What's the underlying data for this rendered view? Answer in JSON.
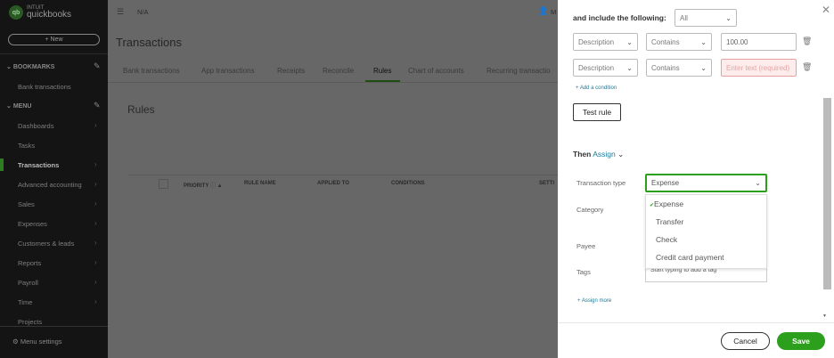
{
  "sidebar": {
    "logo_top": "INTUIT",
    "logo_bottom": "quickbooks",
    "new_label": "+ New",
    "bookmarks_label": "BOOKMARKS",
    "bookmark_items": [
      "Bank transactions"
    ],
    "menu_label": "MENU",
    "menu_items": [
      "Dashboards",
      "Tasks",
      "Transactions",
      "Advanced accounting",
      "Sales",
      "Expenses",
      "Customers & leads",
      "Reports",
      "Payroll",
      "Time",
      "Projects"
    ],
    "active_item": "Transactions",
    "menu_settings": "Menu settings"
  },
  "header": {
    "company": "N/A",
    "user_initial": "M"
  },
  "main": {
    "title": "Transactions",
    "tabs": [
      "Bank transactions",
      "App transactions",
      "Receipts",
      "Reconcile",
      "Rules",
      "Chart of accounts",
      "Recurring transactio"
    ],
    "active_tab": "Rules",
    "section_title": "Rules",
    "columns": [
      "PRIORITY",
      "RULE NAME",
      "APPLIED TO",
      "CONDITIONS",
      "SETTI"
    ]
  },
  "panel": {
    "include_label": "and include the following:",
    "include_value": "All",
    "conditions": [
      {
        "field": "Description",
        "operator": "Contains",
        "value": "100.00",
        "placeholder": ""
      },
      {
        "field": "Description",
        "operator": "Contains",
        "value": "",
        "placeholder": "Enter text (required)"
      }
    ],
    "add_condition": "+ Add a condition",
    "test_rule": "Test rule",
    "then_label": "Then",
    "assign_label": "Assign",
    "transaction_type_label": "Transaction type",
    "transaction_type_value": "Expense",
    "type_options": [
      "Expense",
      "Transfer",
      "Check",
      "Credit card payment"
    ],
    "selected_option": "Expense",
    "category_label": "Category",
    "payee_label": "Payee",
    "tags_label": "Tags",
    "tags_placeholder": "Start typing to add a tag",
    "assign_more": "+ Assign more",
    "cancel": "Cancel",
    "save": "Save"
  },
  "colors": {
    "accent_green": "#2ca01c",
    "link_blue": "#1a7a9a",
    "error_bg": "#fdecec"
  }
}
